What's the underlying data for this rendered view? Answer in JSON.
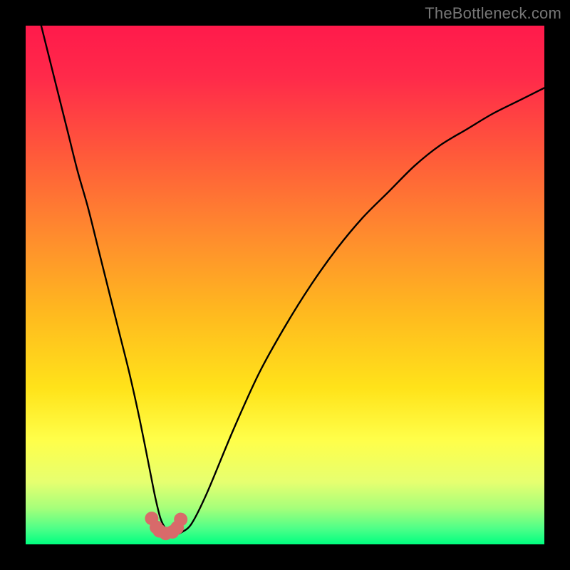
{
  "watermark": {
    "text": "TheBottleneck.com"
  },
  "colors": {
    "frame": "#000000",
    "curve_stroke": "#000000",
    "marker_fill": "#d86a6a",
    "marker_stroke": "#a84a4a",
    "gradient_top": "#ff1a4b",
    "gradient_bottom": "#00ff80"
  },
  "chart_data": {
    "type": "line",
    "title": "",
    "xlabel": "",
    "ylabel": "",
    "xlim": [
      0,
      100
    ],
    "ylim": [
      0,
      100
    ],
    "legend": false,
    "grid": false,
    "annotations": [],
    "series": [
      {
        "name": "curve",
        "x": [
          3,
          5,
          8,
          10,
          12,
          14,
          16,
          18,
          20,
          22,
          24,
          25,
          26,
          27,
          28,
          29,
          30,
          32,
          35,
          40,
          45,
          50,
          55,
          60,
          65,
          70,
          75,
          80,
          85,
          90,
          95,
          100
        ],
        "y": [
          100,
          92,
          80,
          72,
          65,
          57,
          49,
          41,
          33,
          24,
          14,
          9,
          5,
          3,
          2.2,
          2,
          2.3,
          4,
          10,
          22,
          33,
          42,
          50,
          57,
          63,
          68,
          73,
          77,
          80,
          83,
          85.5,
          88
        ]
      },
      {
        "name": "markers",
        "x": [
          24.3,
          25.2,
          25.8,
          27.0,
          28.3,
          29.2,
          29.9
        ],
        "y": [
          5.0,
          3.3,
          2.6,
          2.1,
          2.4,
          3.2,
          4.8
        ]
      }
    ]
  }
}
